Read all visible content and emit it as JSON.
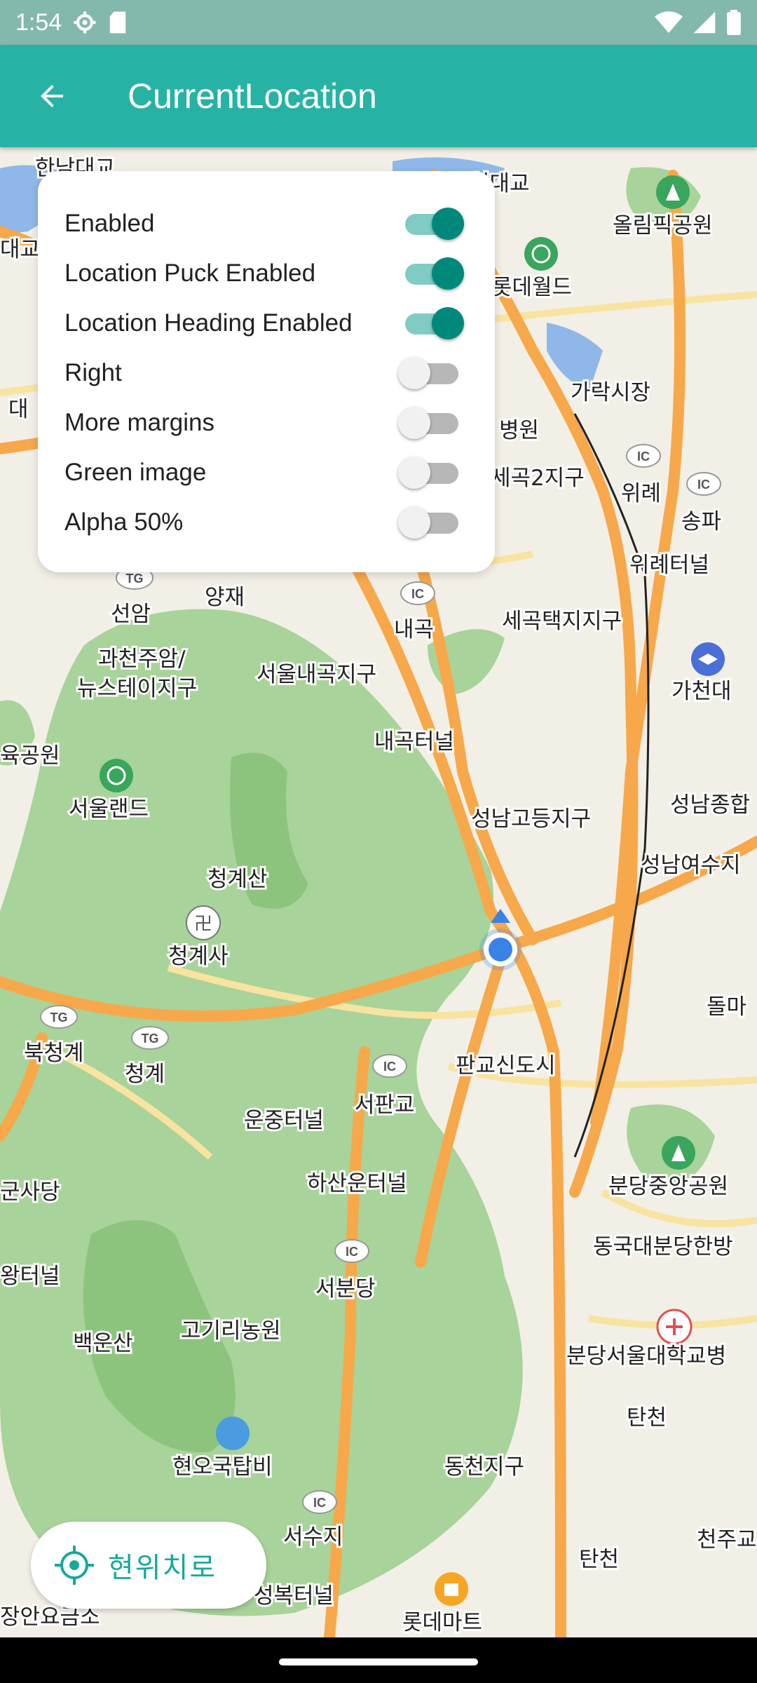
{
  "status_bar": {
    "time": "1:54"
  },
  "app_bar": {
    "title": "CurrentLocation"
  },
  "settings": [
    {
      "label": "Enabled",
      "on": true
    },
    {
      "label": "Location Puck Enabled",
      "on": true
    },
    {
      "label": "Location Heading Enabled",
      "on": true
    },
    {
      "label": "Right",
      "on": false
    },
    {
      "label": "More margins",
      "on": false
    },
    {
      "label": "Green image",
      "on": false
    },
    {
      "label": "Alpha 50%",
      "on": false
    }
  ],
  "locate_button": {
    "label": "현위치로"
  },
  "map": {
    "labels": [
      "한남대교",
      "실대교",
      "올림픽공원",
      "롯데월드",
      "대교",
      "가락시장",
      "병원",
      "위례",
      "세곡2지구",
      "송파",
      "위례터널",
      "양재",
      "선암",
      "내곡",
      "세곡택지지구",
      "과천주암/",
      "뉴스테이지구",
      "서울내곡지구",
      "가천대",
      "육공원",
      "서울랜드",
      "내곡터널",
      "성남고등지구",
      "성남종합",
      "청계산",
      "성남여수지",
      "청계사",
      "돌마",
      "북청계",
      "청계",
      "판교신도시",
      "서판교",
      "운중터널",
      "분당중앙공원",
      "하산운터널",
      "군사당",
      "동국대분당한방",
      "서분당",
      "왕터널",
      "고기리농원",
      "백운산",
      "분당서울대학교병",
      "탄천",
      "현오국탑비",
      "동천지구",
      "서수지",
      "천주교",
      "성복터널",
      "장안요금소",
      "롯데마트",
      "대"
    ],
    "badges": [
      "TG",
      "IC"
    ],
    "colors": {
      "park": "#a8d39a",
      "mountain": "#8cc47e",
      "water": "#8fb8e8",
      "road_major": "#f7a84a",
      "road_minor": "#f8e3a0",
      "background": "#f2efe6"
    }
  },
  "colors": {
    "status_bar": "#83b9ad",
    "app_bar": "#26b3a5",
    "switch_on": "#00897b",
    "accent_text": "#18a89a",
    "puck": "#3b82e6"
  }
}
